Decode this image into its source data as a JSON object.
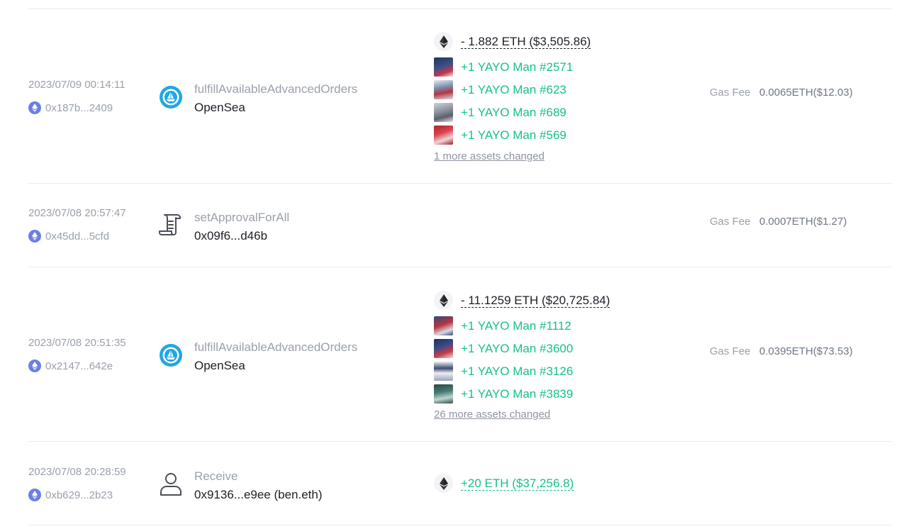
{
  "transactions": [
    {
      "time": "2023/07/09 00:14:11",
      "hash": "0x187b...2409",
      "method": "fulfillAvailableAdvancedOrders",
      "target": "OpenSea",
      "icon": "opensea-icon",
      "eth_change": "- 1.882 ETH ($3,505.86)",
      "nfts": [
        "+1 YAYO Man #2571",
        "+1 YAYO Man #623",
        "+1 YAYO Man #689",
        "+1 YAYO Man #569"
      ],
      "more": "1 more assets changed",
      "gas_label": "Gas Fee",
      "gas_value": "0.0065ETH($12.03)"
    },
    {
      "time": "2023/07/08 20:57:47",
      "hash": "0x45dd...5cfd",
      "method": "setApprovalForAll",
      "target": "0x09f6...d46b",
      "icon": "contract-scroll-icon",
      "gas_label": "Gas Fee",
      "gas_value": "0.0007ETH($1.27)"
    },
    {
      "time": "2023/07/08 20:51:35",
      "hash": "0x2147...642e",
      "method": "fulfillAvailableAdvancedOrders",
      "target": "OpenSea",
      "icon": "opensea-icon",
      "eth_change": "- 11.1259 ETH ($20,725.84)",
      "nfts": [
        "+1 YAYO Man #1112",
        "+1 YAYO Man #3600",
        "+1 YAYO Man #3126",
        "+1 YAYO Man #3839"
      ],
      "more": "26 more assets changed",
      "gas_label": "Gas Fee",
      "gas_value": "0.0395ETH($73.53)"
    },
    {
      "time": "2023/07/08 20:28:59",
      "hash": "0xb629...2b23",
      "method": "Receive",
      "target": "0x9136...e9ee (ben.eth)",
      "icon": "user-icon",
      "eth_change": "+20 ETH ($37,256.8)"
    }
  ],
  "colors": {
    "positive": "#16c08a",
    "muted": "#9aa0ab",
    "text": "#1c1f26",
    "chain": "#6a7fe8",
    "opensea": "#20a6e4"
  }
}
